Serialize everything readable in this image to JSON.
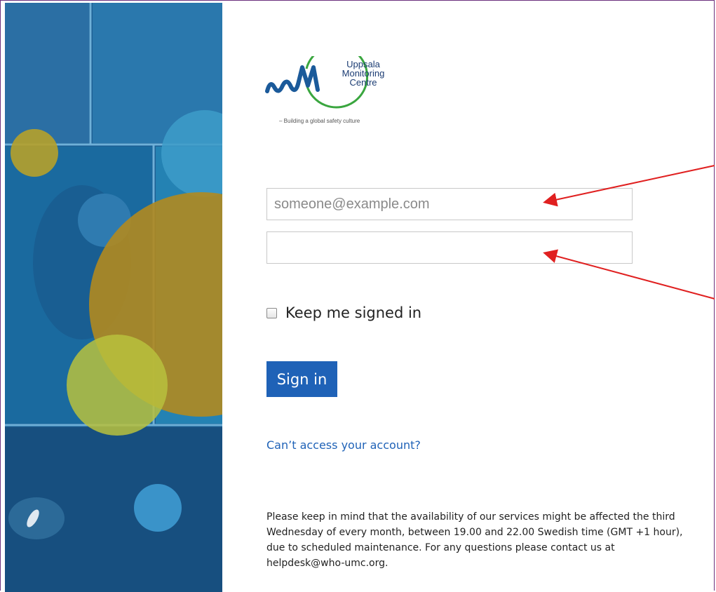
{
  "brand": {
    "name_line1": "Uppsala",
    "name_line2": "Monitoring",
    "name_line3": "Centre",
    "tagline": "– Building a global safety culture",
    "colors": {
      "green": "#3aa63f",
      "blue": "#1b5a9a"
    }
  },
  "form": {
    "email_placeholder": "someone@example.com",
    "password_value": "",
    "keep_signed_in_label": "Keep me signed in",
    "keep_signed_in_checked": false,
    "signin_label": "Sign in",
    "cant_access_label": "Can’t access your account?"
  },
  "notice": {
    "text": "Please keep in mind that the availability of our services might be affected the third Wednesday of every month, between 19.00 and 22.00 Swedish time (GMT +1 hour), due to scheduled maintenance. For any questions please contact us at helpdesk@who-umc.org."
  },
  "colors": {
    "accent": "#1f62b7",
    "annotation_arrow": "#e02020",
    "side_panel": "#1d5f93"
  }
}
